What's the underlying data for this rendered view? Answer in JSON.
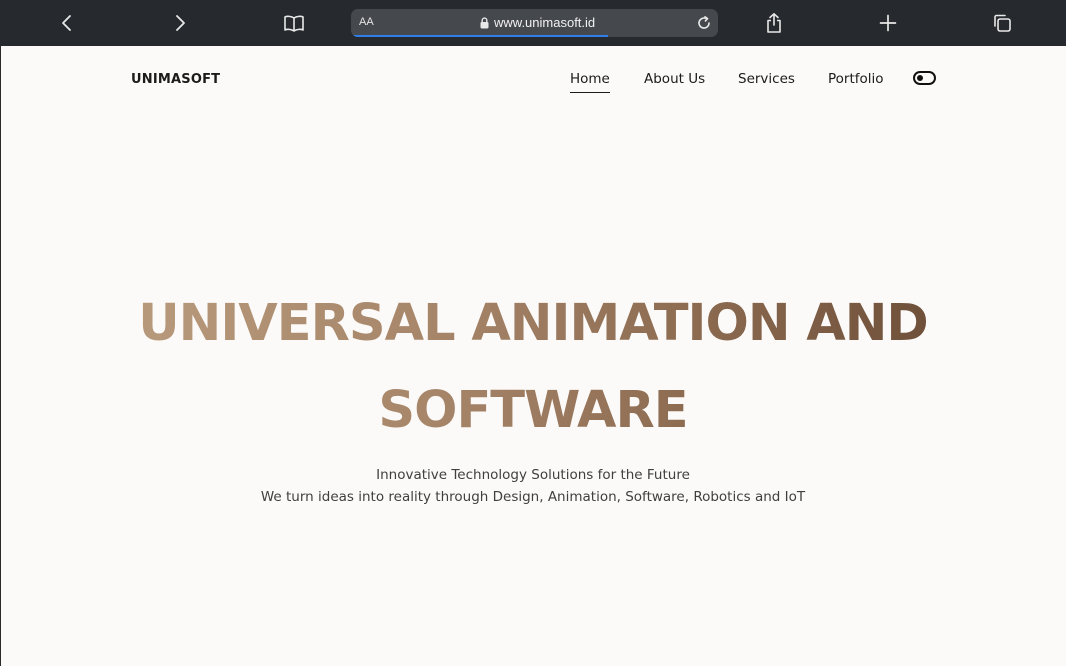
{
  "browser": {
    "text_size_label": "AA",
    "url": "www.unimasoft.id",
    "load_progress": 0.7,
    "icons": [
      "back-icon",
      "forward-icon",
      "bookmarks-icon",
      "lock-icon",
      "reload-icon",
      "share-icon",
      "new-tab-icon",
      "tabs-icon"
    ]
  },
  "site": {
    "logo": "UNIMASOFT",
    "nav": [
      {
        "label": "Home",
        "active": true
      },
      {
        "label": "About Us",
        "active": false
      },
      {
        "label": "Services",
        "active": false
      },
      {
        "label": "Portfolio",
        "active": false
      }
    ],
    "theme_toggle_icon": "toggle-icon"
  },
  "hero": {
    "title_line1": "UNIVERSAL ANIMATION AND",
    "title_line2": "SOFTWARE",
    "tagline": "Innovative Technology Solutions for the Future",
    "description": "We turn ideas into reality through Design, Animation, Software, Robotics and IoT"
  },
  "colors": {
    "toolbar_bg": "#262a2e",
    "address_bar_bg": "#45484c",
    "progress": "#2f7ee8",
    "page_bg": "#fcfaf8",
    "title_gradient_start": "#bfa283",
    "title_gradient_end": "#5e402c"
  }
}
